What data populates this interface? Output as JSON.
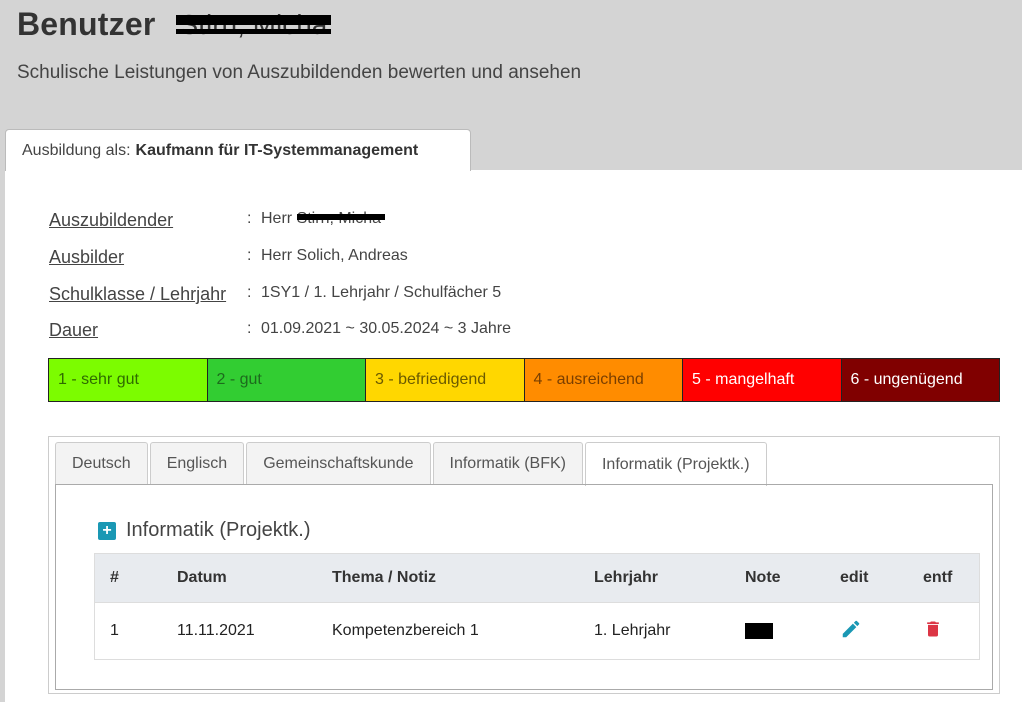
{
  "header": {
    "title": "Benutzer",
    "name_redacted": "Stirn, Micha",
    "subtitle": "Schulische Leistungen von Auszubildenden bewerten und ansehen"
  },
  "top_tab": {
    "prefix": "Ausbildung als:",
    "value": "Kaufmann für IT-Systemmanagement"
  },
  "info": {
    "rows": [
      {
        "label": "Auszubildender",
        "value_prefix": "Herr ",
        "value_redacted": "Stirn, Micha"
      },
      {
        "label": "Ausbilder",
        "value": "Herr Solich, Andreas"
      },
      {
        "label": "Schulklasse / Lehrjahr",
        "value": "1SY1 / 1. Lehrjahr / Schulfächer 5"
      },
      {
        "label": "Dauer",
        "value": "01.09.2021 ~ 30.05.2024 ~ 3 Jahre"
      }
    ],
    "separator": ":"
  },
  "legend": [
    {
      "label": "1 - sehr gut",
      "bg": "#7cfc00",
      "color": "#2e6b00"
    },
    {
      "label": "2 - gut",
      "bg": "#32cd32",
      "color": "#1d6b1d"
    },
    {
      "label": "3 - befriedigend",
      "bg": "#ffd700",
      "color": "#6b5a00"
    },
    {
      "label": "4 - ausreichend",
      "bg": "#ff8c00",
      "color": "#7a3f00"
    },
    {
      "label": "5 - mangelhaft",
      "bg": "#ff0000",
      "color": "#ffffff"
    },
    {
      "label": "6 - ungenügend",
      "bg": "#800000",
      "color": "#ffffff"
    }
  ],
  "subject_tabs": [
    {
      "label": "Deutsch"
    },
    {
      "label": "Englisch"
    },
    {
      "label": "Gemeinschaftskunde"
    },
    {
      "label": "Informatik (BFK)"
    },
    {
      "label": "Informatik (Projektk.)",
      "active": true
    }
  ],
  "section": {
    "title": "Informatik (Projektk.)"
  },
  "table": {
    "headers": [
      "#",
      "Datum",
      "Thema / Notiz",
      "Lehrjahr",
      "Note",
      "edit",
      "entf"
    ],
    "rows": [
      {
        "nr": "1",
        "datum": "11.11.2021",
        "thema": "Kompetenzbereich 1",
        "lehrjahr": "1. Lehrjahr"
      }
    ]
  },
  "colors": {
    "accent": "#1a98b4",
    "delete": "#dc3545",
    "header_bg": "#d4d4d4"
  }
}
